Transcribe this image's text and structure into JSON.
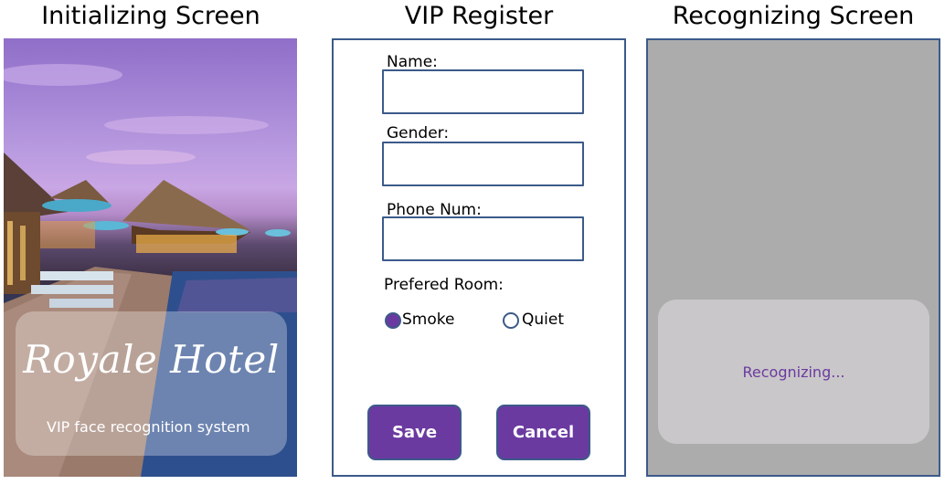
{
  "titles": {
    "initializing": "Initializing Screen",
    "vip_register": "VIP Register",
    "recognizing": "Recognizing Screen"
  },
  "initializing_screen": {
    "hotel_name": "Royale Hotel",
    "subtitle": "VIP face recognition system"
  },
  "vip_register": {
    "name_label": "Name:",
    "name_value": "",
    "gender_label": "Gender:",
    "gender_value": "",
    "phone_label": "Phone Num:",
    "phone_value": "",
    "room_label": "Prefered Room:",
    "options": [
      {
        "label": "Smoke",
        "selected": true
      },
      {
        "label": "Quiet",
        "selected": false
      }
    ],
    "save_label": "Save",
    "cancel_label": "Cancel"
  },
  "recognizing_screen": {
    "status_text": "Recognizing..."
  },
  "colors": {
    "accent": "#6b3aa0",
    "border": "#3c5a8a",
    "recognizing_bg": "#acacac"
  }
}
